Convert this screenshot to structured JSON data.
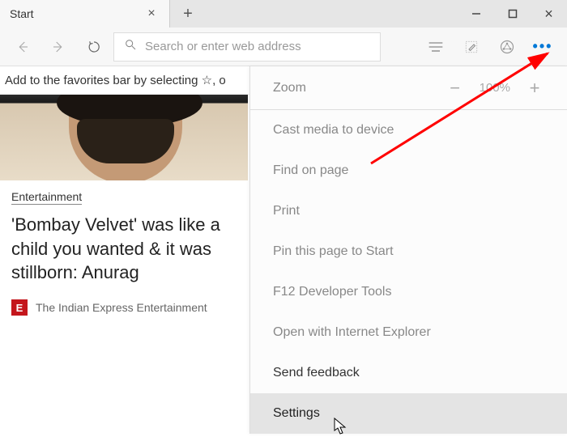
{
  "tab": {
    "title": "Start"
  },
  "search": {
    "placeholder": "Search or enter web address"
  },
  "favhint": "Add to the favorites bar by selecting ☆, o",
  "card": {
    "tag": "Entertainment",
    "headline": "'Bombay Velvet' was like a child you wanted & it was stillborn: Anurag",
    "source_badge": "E",
    "source": "The Indian Express Entertainment"
  },
  "menu": {
    "zoom_label": "Zoom",
    "zoom_value": "100%",
    "items": {
      "cast": "Cast media to device",
      "find": "Find on page",
      "print": "Print",
      "pin": "Pin this page to Start",
      "f12": "F12 Developer Tools",
      "ie": "Open with Internet Explorer",
      "feedback": "Send feedback",
      "settings": "Settings"
    }
  }
}
